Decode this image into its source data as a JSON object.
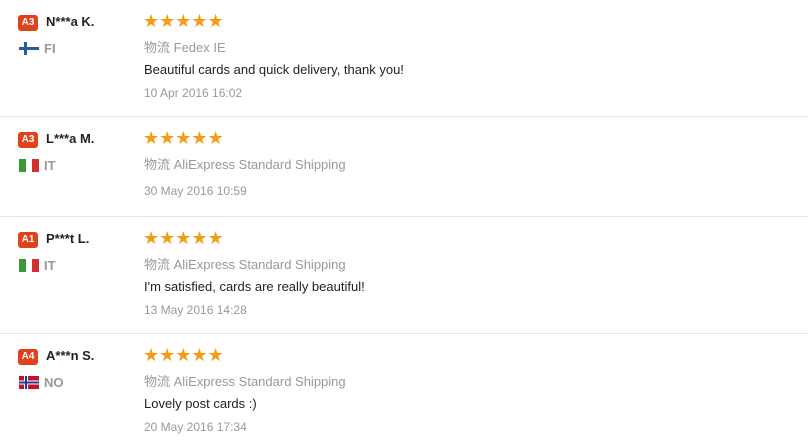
{
  "reviews": [
    {
      "badge": "A3",
      "name": "N***a K.",
      "country": "FI",
      "flag": "finland-flag-icon",
      "stars": "★★★★★",
      "rating": 5,
      "shipping_label": "物流",
      "shipping": "Fedex IE",
      "comment": "Beautiful cards and quick delivery, thank you!",
      "date": "10 Apr 2016 16:02"
    },
    {
      "badge": "A3",
      "name": "L***a M.",
      "country": "IT",
      "flag": "italy-flag-icon",
      "stars": "★★★★★",
      "rating": 5,
      "shipping_label": "物流",
      "shipping": "AliExpress Standard Shipping",
      "comment": "",
      "date": "30 May 2016 10:59"
    },
    {
      "badge": "A1",
      "name": "P***t L.",
      "country": "IT",
      "flag": "italy-flag-icon",
      "stars": "★★★★★",
      "rating": 5,
      "shipping_label": "物流",
      "shipping": "AliExpress Standard Shipping",
      "comment": "I'm satisfied, cards are really beautiful!",
      "date": "13 May 2016 14:28"
    },
    {
      "badge": "A4",
      "name": "A***n S.",
      "country": "NO",
      "flag": "norway-flag-icon",
      "stars": "★★★★★",
      "rating": 5,
      "shipping_label": "物流",
      "shipping": "AliExpress Standard Shipping",
      "comment": "Lovely post cards :)",
      "date": "20 May 2016 17:34"
    }
  ],
  "colors": {
    "badge": "#e0421c",
    "stars": "#f39c12",
    "muted": "#999999",
    "divider": "#e6e6e6"
  }
}
